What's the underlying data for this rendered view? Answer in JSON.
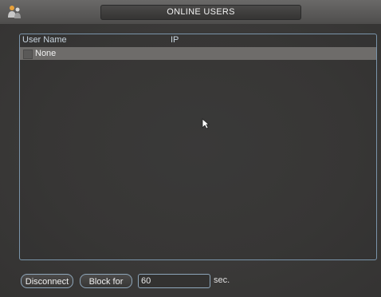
{
  "window": {
    "title": "ONLINE USERS",
    "icon": "users-icon"
  },
  "list": {
    "columns": [
      "User Name",
      "IP"
    ],
    "rows": [
      {
        "user": "None",
        "ip": "",
        "checked": false
      }
    ]
  },
  "controls": {
    "disconnect_label": "Disconnect",
    "block_label": "Block for",
    "block_seconds": "60",
    "seconds_unit": "sec."
  }
}
